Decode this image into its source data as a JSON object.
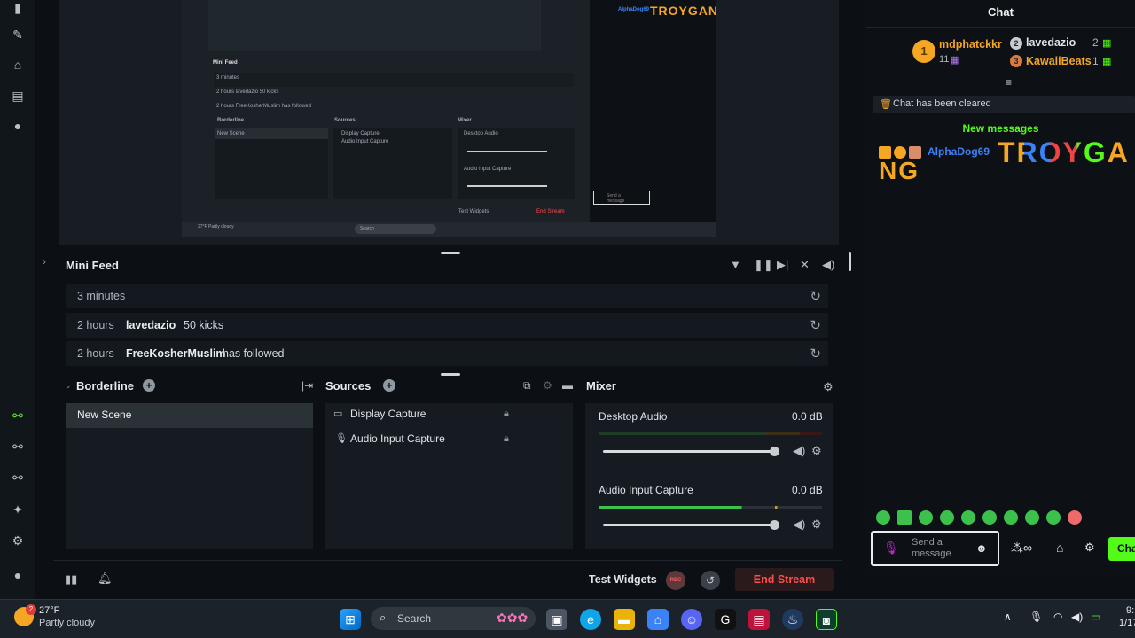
{
  "preview": {
    "mini_feed_label": "Mini Feed",
    "mini_rows": [
      "3 minutes",
      "2 hours lavedazio 50 kicks",
      "2 hours FreeKosherMuslim has followed"
    ],
    "mini_panels": [
      "Borderline",
      "Sources",
      "Mixer"
    ],
    "mini_scene": "New Scene",
    "mini_sources": [
      "Display Capture",
      "Audio Input Capture"
    ],
    "mini_mix": [
      "Desktop Audio",
      "Audio Input Capture"
    ],
    "mini_test": "Test Widgets",
    "mini_end": "End Stream",
    "mini_weather": "27°F Partly cloudy",
    "mini_search": "Search",
    "mini_chat_name": "AlphaDog69",
    "mini_chat_msg": "TROYGANG",
    "mini_chat_input": "Send a message"
  },
  "minifeed": {
    "title": "Mini Feed",
    "rows": [
      {
        "time": "3 minutes",
        "user": "",
        "text": ""
      },
      {
        "time": "2 hours",
        "user": "lavedazio",
        "text": "50 kicks"
      },
      {
        "time": "2 hours",
        "user": "FreeKosherMuslim",
        "text": "has followed"
      }
    ]
  },
  "scenes": {
    "title": "Borderline",
    "items": [
      "New Scene"
    ]
  },
  "sources": {
    "title": "Sources",
    "items": [
      "Display Capture",
      "Audio Input Capture"
    ]
  },
  "mixer": {
    "title": "Mixer",
    "channels": [
      {
        "name": "Desktop Audio",
        "db": "0.0 dB",
        "level": 0.95
      },
      {
        "name": "Audio Input Capture",
        "db": "0.0 dB",
        "level": 0.95
      }
    ]
  },
  "footer": {
    "test_widgets": "Test Widgets",
    "rec": "REC",
    "end_stream": "End Stream"
  },
  "chat": {
    "title": "Chat",
    "top_gifter": {
      "name": "mdphatckkr",
      "count": "11",
      "rank": "1"
    },
    "gifters": [
      {
        "rank": "2",
        "name": "lavedazio",
        "count": "2"
      },
      {
        "rank": "3",
        "name": "KawaiiBeats",
        "count": "1"
      }
    ],
    "cleared": "Chat has been cleared",
    "new_messages": "New messages",
    "message": {
      "user": "AlphaDog69",
      "text_line1": "TROYGA",
      "text_line2": "NG"
    },
    "input_placeholder": "Send a message",
    "chat_button": "Chat"
  },
  "taskbar": {
    "temp": "27°F",
    "weather": "Partly cloudy",
    "search": "Search",
    "clock_time": "9:",
    "clock_date": "1/17"
  },
  "colors": {
    "accent_green": "#53fc18",
    "end_stream": "#ff4c4c",
    "gold": "#f5a623"
  }
}
